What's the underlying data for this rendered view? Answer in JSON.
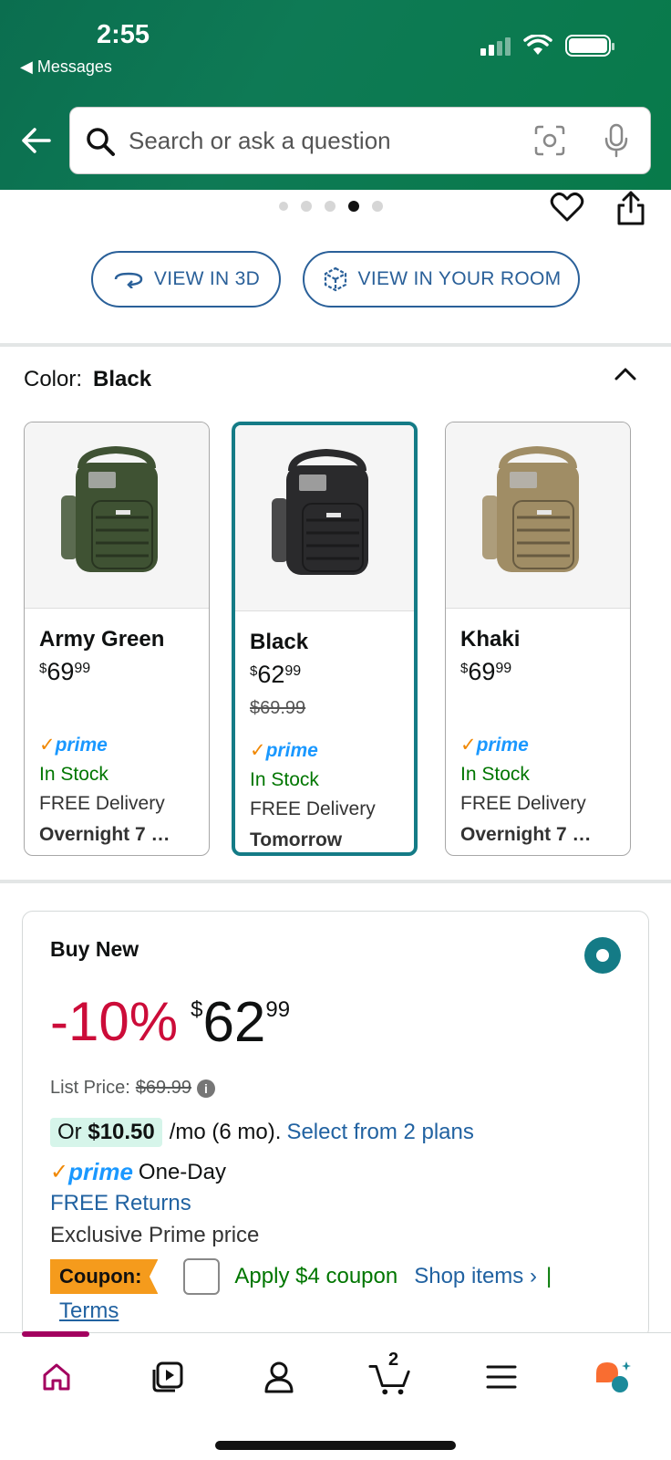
{
  "status_bar": {
    "time": "2:55",
    "back_app": "◀ Messages"
  },
  "search": {
    "placeholder": "Search or ask a question"
  },
  "carousel": {
    "dot_count": 5,
    "active_dot": 4
  },
  "view_buttons": {
    "view_3d": "VIEW IN 3D",
    "view_room": "VIEW IN YOUR ROOM"
  },
  "color": {
    "label": "Color:",
    "selected": "Black"
  },
  "swatches": [
    {
      "name": "Army Green",
      "price_symbol": "$",
      "price_whole": "69",
      "price_cents": "99",
      "list_price": "",
      "prime": "prime",
      "stock": "In Stock",
      "delivery": "FREE Delivery",
      "eta": "Overnight 7 …",
      "bag_color": "#3f5233",
      "selected": false
    },
    {
      "name": "Black",
      "price_symbol": "$",
      "price_whole": "62",
      "price_cents": "99",
      "list_price": "$69.99",
      "prime": "prime",
      "stock": "In Stock",
      "delivery": "FREE Delivery",
      "eta": "Tomorrow",
      "bag_color": "#2a2a2c",
      "selected": true
    },
    {
      "name": "Khaki",
      "price_symbol": "$",
      "price_whole": "69",
      "price_cents": "99",
      "list_price": "",
      "prime": "prime",
      "stock": "In Stock",
      "delivery": "FREE Delivery",
      "eta": "Overnight 7 …",
      "bag_color": "#a08d65",
      "selected": false
    }
  ],
  "buy_box": {
    "title": "Buy New",
    "discount": "-10%",
    "price_symbol": "$",
    "price_whole": "62",
    "price_cents": "99",
    "list_price_label": "List Price:",
    "list_price": "$69.99",
    "monthly_prefix": "Or",
    "monthly_amount": "$10.50",
    "monthly_suffix": "/mo (6 mo).",
    "plans_link": "Select from 2 plans",
    "prime_word": "prime",
    "prime_speed": "One-Day",
    "free_returns": "FREE Returns",
    "exclusive": "Exclusive Prime price",
    "coupon_tag": "Coupon:",
    "apply_coupon": "Apply $4 coupon",
    "shop_items": "Shop items ›",
    "separator": "|",
    "terms": "Terms"
  },
  "bottom_nav": {
    "cart_count": "2",
    "items": [
      "home-icon",
      "video-icon",
      "account-icon",
      "cart-icon",
      "menu-icon",
      "rufus-icon"
    ]
  },
  "colors": {
    "header_green": "#0b6e4f",
    "link_blue": "#2162a1",
    "selected_teal": "#147b86",
    "discount_red": "#cc0c39",
    "stock_green": "#007600",
    "coupon_orange": "#f59b1c"
  }
}
